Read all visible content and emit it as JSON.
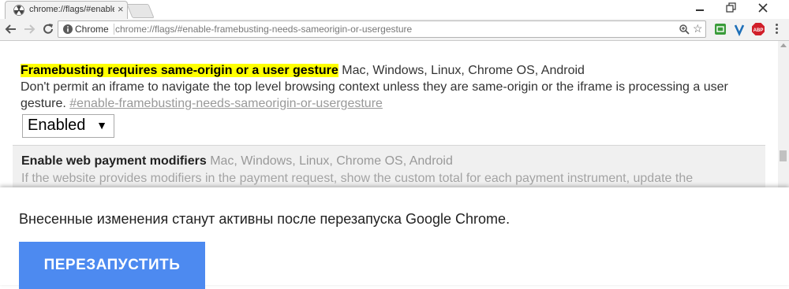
{
  "browser": {
    "tab_title": "chrome://flags/#enable-",
    "tab_close": "×",
    "omnibox_chip": "Chrome",
    "url": "chrome://flags/#enable-framebusting-needs-sameorigin-or-usergesture",
    "star": "☆"
  },
  "experiments": [
    {
      "title": "Framebusting requires same-origin or a user gesture",
      "platforms": "Mac, Windows, Linux, Chrome OS, Android",
      "description": "Don't permit an iframe to navigate the top level browsing context unless they are same-origin or the iframe is processing a user gesture.",
      "link": "#enable-framebusting-needs-sameorigin-or-usergesture",
      "select_value": "Enabled",
      "select_arrow": "▼"
    },
    {
      "title": "Enable web payment modifiers",
      "platforms": "Mac, Windows, Linux, Chrome OS, Android",
      "description": "If the website provides modifiers in the payment request, show the custom total for each payment instrument, update the"
    }
  ],
  "restart": {
    "message": "Внесенные изменения станут активны после перезапуска Google Chrome.",
    "button_label": "ПЕРЕЗАПУСТИТЬ"
  },
  "colors": {
    "highlight": "#ffff00",
    "button_blue": "#4d8af0"
  }
}
